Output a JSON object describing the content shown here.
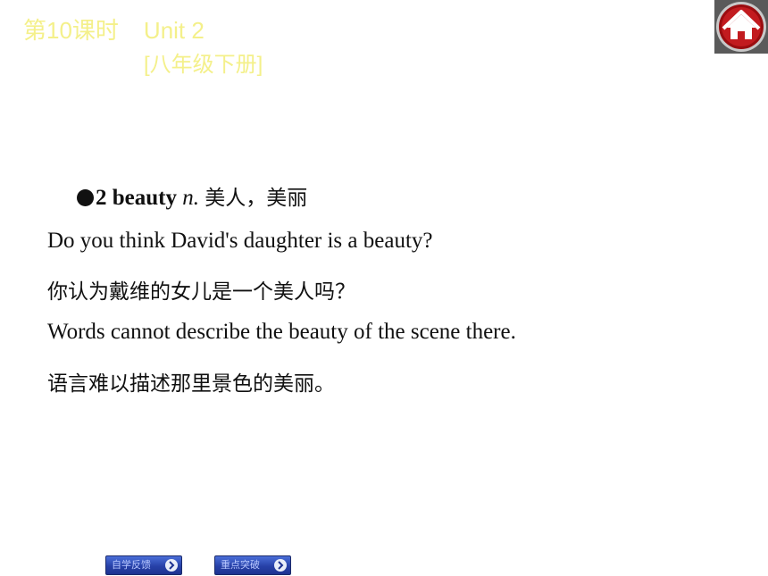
{
  "header": {
    "lesson": "第10课时",
    "unit": "Unit 2",
    "book": "[八年级下册]"
  },
  "home_button": {
    "icon": "home-icon"
  },
  "entry": {
    "bullet_icon": "bullet-dot-icon",
    "number": "2",
    "word": "beauty",
    "pos": "n.",
    "meaning": "美人，美丽"
  },
  "examples": [
    {
      "en": "Do you think David's daughter is a beauty?",
      "cn": "你认为戴维的女儿是一个美人吗？"
    },
    {
      "en": "Words cannot describe the beauty of the scene there.",
      "cn": "语言难以描述那里景色的美丽。"
    }
  ],
  "footer": {
    "left_button": "自学反馈",
    "right_button": "重点突破"
  },
  "colors": {
    "header_text": "#f4f08a",
    "nav_button": "#2741a8"
  }
}
